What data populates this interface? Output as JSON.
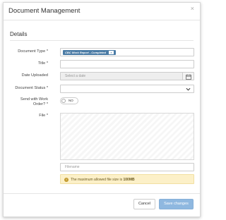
{
  "modal": {
    "title": "Document Management",
    "close_glyph": "×",
    "section_title": "Details"
  },
  "form": {
    "document_type": {
      "label": "Document Type *",
      "chip": "CBC Work Report - Completed",
      "chip_remove": "×"
    },
    "title": {
      "label": "Title *",
      "value": ""
    },
    "date_uploaded": {
      "label": "Date Uploaded",
      "placeholder": "Select a date",
      "icon": "calendar-icon"
    },
    "document_status": {
      "label": "Document Status *",
      "value": "",
      "icon": "chevron-down-icon"
    },
    "send_with_work_order": {
      "label": "Send with Work Order? *",
      "toggle_text": "NO"
    },
    "file": {
      "label": "File *",
      "filename_placeholder": "Filename"
    },
    "info": {
      "text_prefix": "The maximum allowed file size is",
      "text_value": "100MB",
      "color": "#fcf0c8"
    }
  },
  "footer": {
    "cancel_label": "Cancel",
    "save_label": "Save changes",
    "save_color": "#8fb8e0"
  }
}
